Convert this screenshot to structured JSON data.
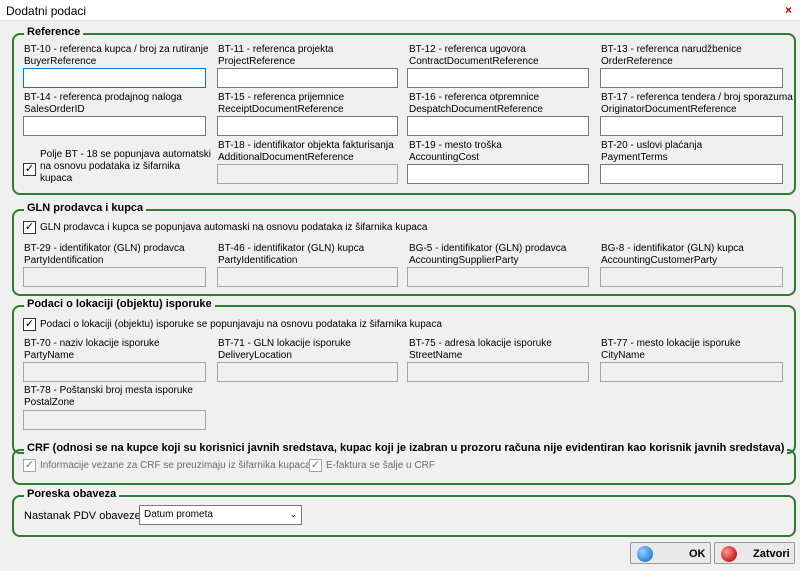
{
  "window": {
    "title": "Dodatni podaci",
    "close": "×"
  },
  "reference": {
    "legend": "Reference",
    "fields": [
      {
        "label1": "BT-10 - referenca kupca / broj za rutiranje",
        "label2": "BuyerReference"
      },
      {
        "label1": "BT-11 - referenca projekta",
        "label2": "ProjectReference"
      },
      {
        "label1": "BT-12 - referenca ugovora",
        "label2": "ContractDocumentReference"
      },
      {
        "label1": "BT-13 - referenca narudžbenice",
        "label2": "OrderReference"
      },
      {
        "label1": "BT-14 - referenca prodajnog naloga",
        "label2": "SalesOrderID"
      },
      {
        "label1": "BT-15 - referenca prijemnice",
        "label2": "ReceiptDocumentReference"
      },
      {
        "label1": "BT-16 - referenca otpremnice",
        "label2": "DespatchDocumentReference"
      },
      {
        "label1": "BT-17 - referenca tendera / broj sporazuma",
        "label2": "OriginatorDocumentReference"
      },
      {
        "label1": "BT-18 - identifikator objekta fakturisanja",
        "label2": "AdditionalDocumentReference"
      },
      {
        "label1": "BT-19 - mesto troška",
        "label2": "AccountingCost"
      },
      {
        "label1": "BT-20 - uslovi plaćanja",
        "label2": "PaymentTerms"
      }
    ],
    "bt18_checkbox": {
      "line1": "Polje BT - 18 se popunjava automatski",
      "line2": "na osnovu podataka iz šifarnika",
      "line3": "kupaca",
      "checked": true,
      "mark": "✓"
    }
  },
  "gln": {
    "legend": "GLN prodavca i kupca",
    "checkbox": {
      "label": "GLN prodavca i kupca se popunjava automaski na osnovu podataka iz šifarnika kupaca",
      "checked": true,
      "mark": "✓"
    },
    "fields": [
      {
        "label1": "BT-29 - identifikator (GLN) prodavca",
        "label2": "PartyIdentification"
      },
      {
        "label1": "BT-46 - identifikator (GLN) kupca",
        "label2": "PartyIdentification"
      },
      {
        "label1": "BG-5 - identifikator (GLN) prodavca",
        "label2": "AccountingSupplierParty"
      },
      {
        "label1": "BG-8 - identifikator (GLN) kupca",
        "label2": "AccountingCustomerParty"
      }
    ]
  },
  "delivery": {
    "legend": "Podaci o lokaciji (objektu) isporuke",
    "checkbox": {
      "label": "Podaci o lokaciji (objektu) isporuke se popunjavaju na osnovu podataka iz šifarnika kupaca",
      "checked": true,
      "mark": "✓"
    },
    "fields": [
      {
        "label1": "BT-70 - naziv lokacije isporuke",
        "label2": "PartyName"
      },
      {
        "label1": "BT-71 - GLN lokacije isporuke",
        "label2": "DeliveryLocation"
      },
      {
        "label1": "BT-75 - adresa lokacije isporuke",
        "label2": "StreetName"
      },
      {
        "label1": "BT-77 - mesto lokacije isporuke",
        "label2": "CityName"
      },
      {
        "label1": "BT-78 - Poštanski broj mesta isporuke",
        "label2": "PostalZone"
      }
    ]
  },
  "crf": {
    "legend": "CRF (odnosi se na kupce koji su korisnici javnih sredstava, kupac koji je izabran u prozoru računa nije evidentiran kao korisnik javnih sredstava)",
    "checkbox1": {
      "label": "Informacije vezane za CRF se preuzimaju iz šifarnika kupaca",
      "checked": true,
      "mark": "✓"
    },
    "checkbox2": {
      "label": "E-faktura se šalje u CRF",
      "checked": true,
      "mark": "✓"
    }
  },
  "tax": {
    "legend": "Poreska obaveza",
    "label": "Nastanak PDV obaveze:",
    "selected": "Datum prometa",
    "arrow": "⌄"
  },
  "buttons": {
    "ok": "OK",
    "close": "Zatvori"
  },
  "colors": {
    "group_border": "#2e7d32",
    "ok_icon": "#3a8ee6",
    "close_icon": "#d32f2f"
  }
}
